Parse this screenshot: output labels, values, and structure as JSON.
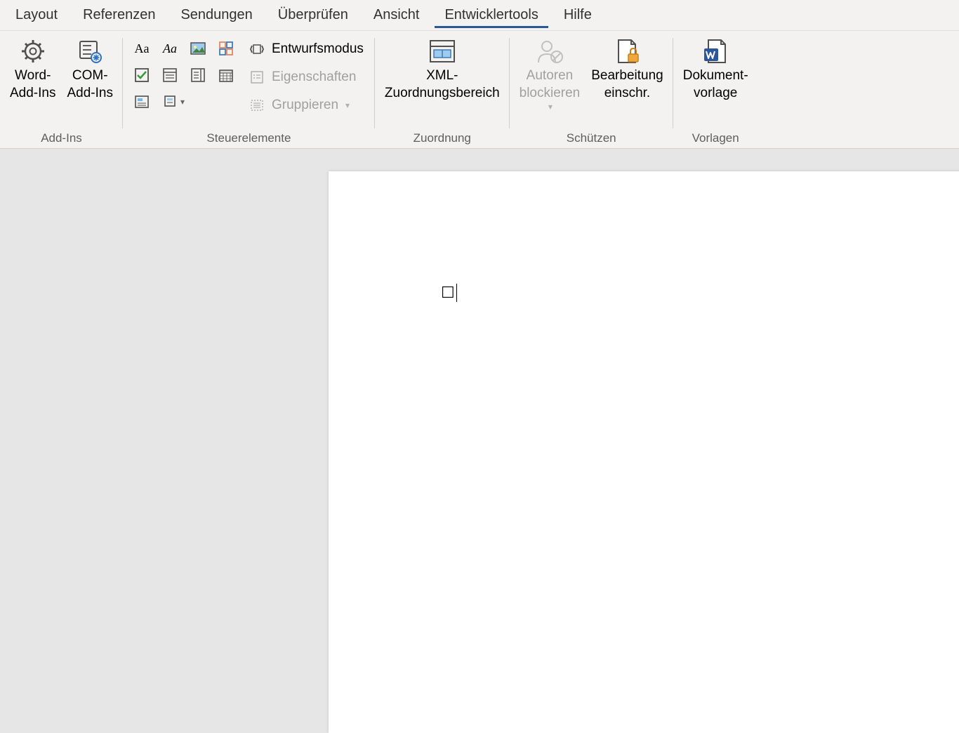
{
  "tabs": [
    "Layout",
    "Referenzen",
    "Sendungen",
    "Überprüfen",
    "Ansicht",
    "Entwicklertools",
    "Hilfe"
  ],
  "active_tab_index": 5,
  "groups": {
    "addins": {
      "label": "Add-Ins",
      "word_addins": "Word-\nAdd-Ins",
      "com_addins": "COM-\nAdd-Ins"
    },
    "controls": {
      "label": "Steuerelemente",
      "design_mode": "Entwurfsmodus",
      "properties": "Eigenschaften",
      "group": "Gruppieren"
    },
    "mapping": {
      "label": "Zuordnung",
      "xml": "XML-\nZuordnungsbereich"
    },
    "protect": {
      "label": "Schützen",
      "block_authors": "Autoren\nblockieren",
      "restrict_editing": "Bearbeitung\neinschr."
    },
    "templates": {
      "label": "Vorlagen",
      "doc_template": "Dokument-\nvorlage"
    }
  },
  "document": {
    "checkbox_glyph": "☐"
  }
}
